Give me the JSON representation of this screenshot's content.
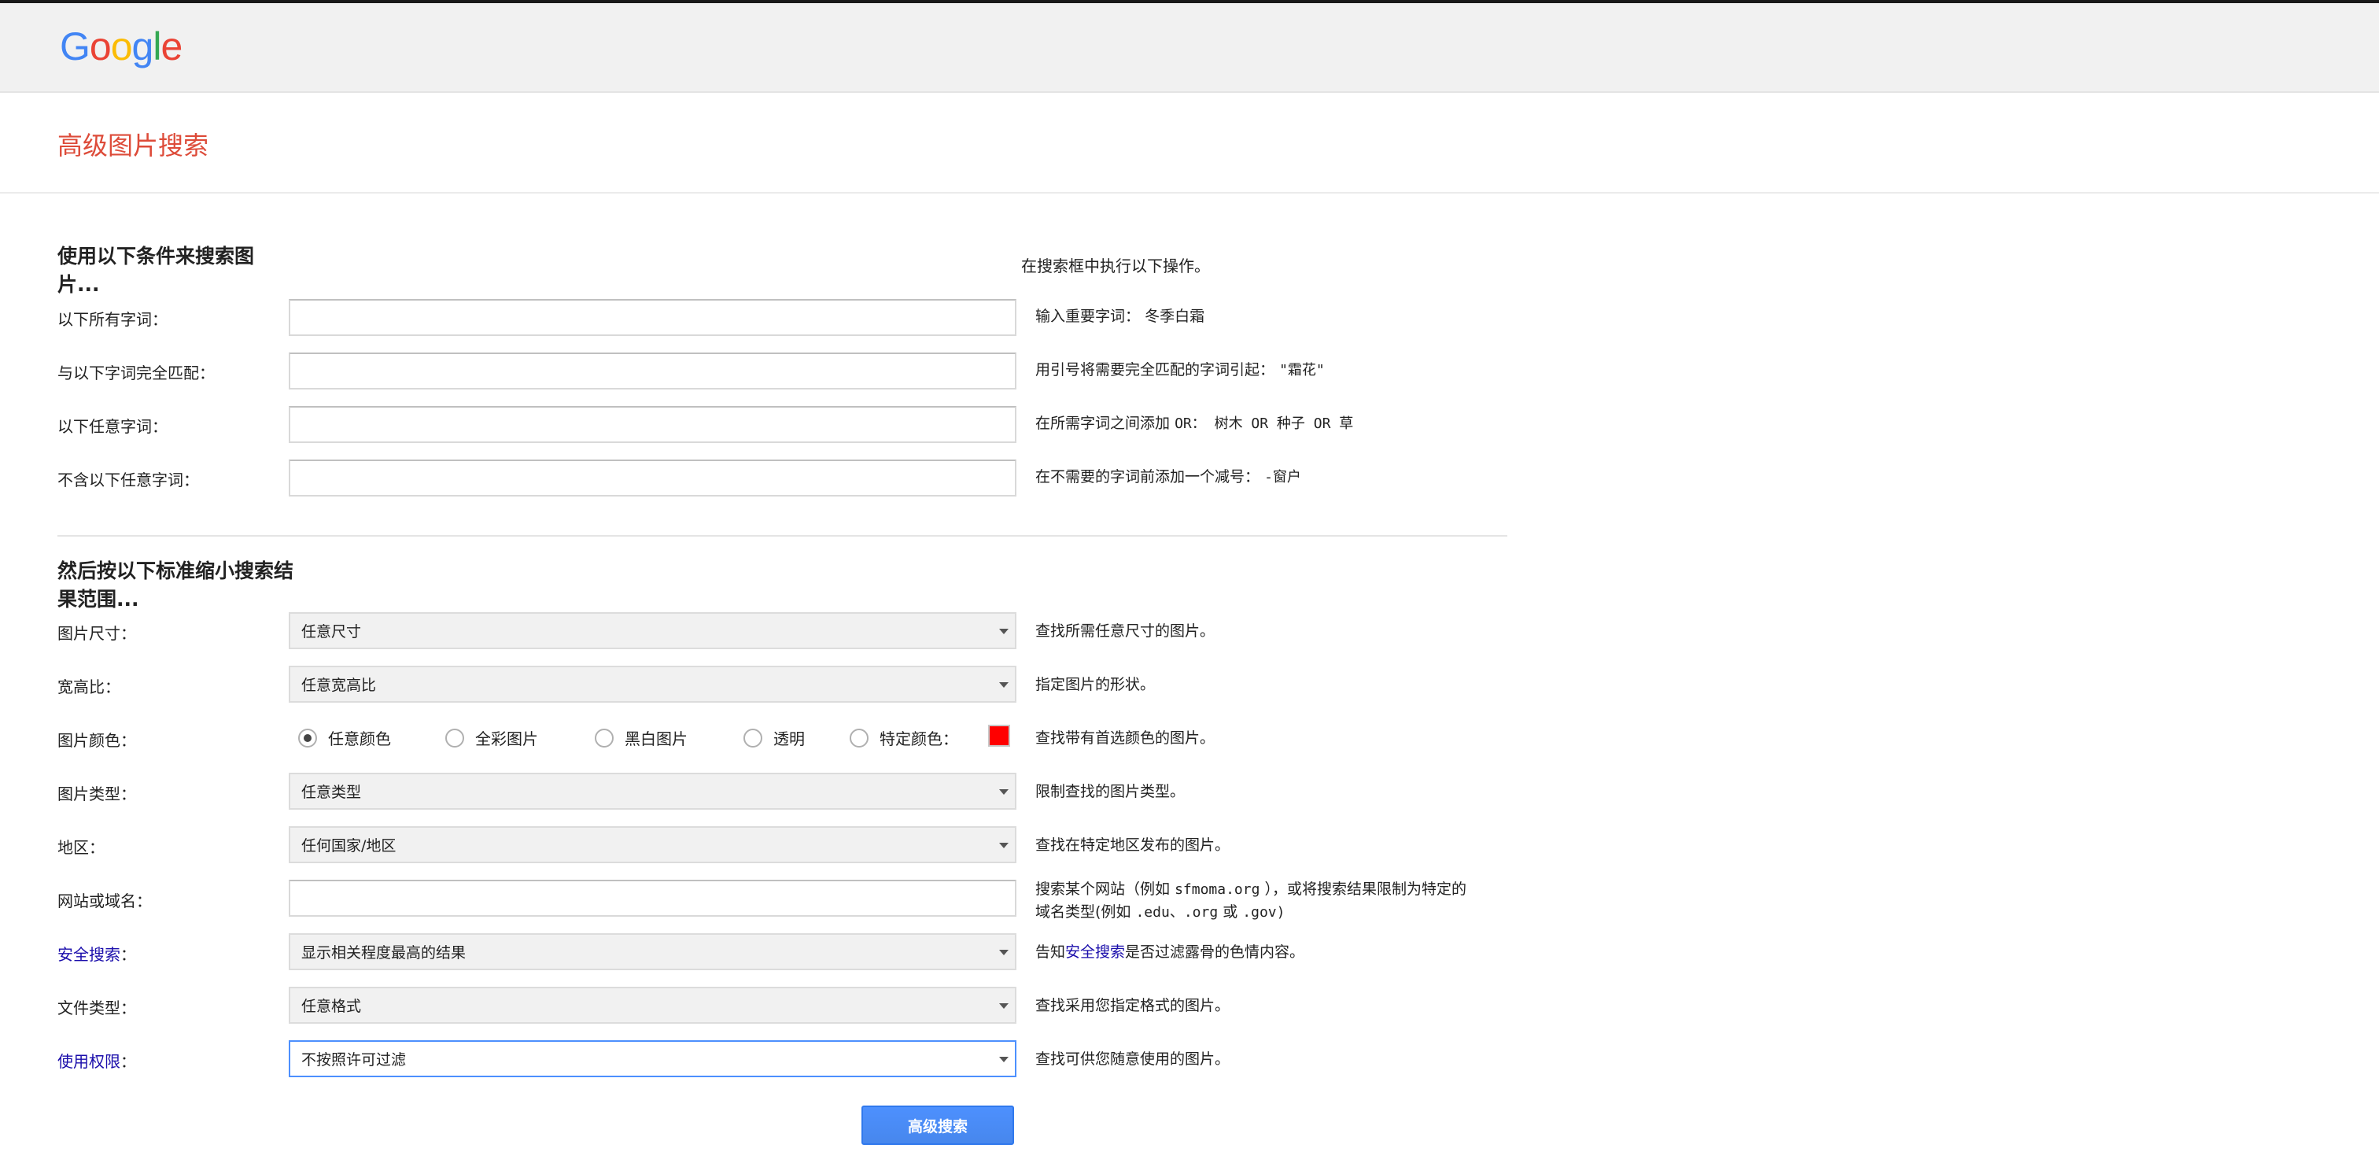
{
  "header": {
    "logo": [
      "G",
      "o",
      "o",
      "g",
      "l",
      "e"
    ],
    "logo_colors": [
      "#4285f4",
      "#ea4335",
      "#fbbc05",
      "#4285f4",
      "#34a853",
      "#ea4335"
    ]
  },
  "page_title": "高级图片搜索",
  "section1": {
    "title": "使用以下条件来搜索图片...",
    "hint_head": "在搜索框中执行以下操作。",
    "rows": [
      {
        "label": "以下所有字词：",
        "value": "",
        "hint_prefix": "输入重要字词：",
        "hint_example": "冬季白霜"
      },
      {
        "label": "与以下字词完全匹配：",
        "value": "",
        "hint_prefix": "用引号将需要完全匹配的字词引起：",
        "hint_example": "\"霜花\""
      },
      {
        "label": "以下任意字词：",
        "value": "",
        "hint_prefix": "在所需字词之间添加",
        "hint_example": "OR：  树木 OR 种子 OR 草"
      },
      {
        "label": "不含以下任意字词：",
        "value": "",
        "hint_prefix": "在不需要的字词前添加一个减号：",
        "hint_example": "-窗户"
      }
    ]
  },
  "section2": {
    "title": "然后按以下标准缩小搜索结果范围...",
    "image_size": {
      "label": "图片尺寸：",
      "value": "任意尺寸",
      "hint": "查找所需任意尺寸的图片。"
    },
    "aspect_ratio": {
      "label": "宽高比：",
      "value": "任意宽高比",
      "hint": "指定图片的形状。"
    },
    "color": {
      "label": "图片颜色：",
      "options": [
        "任意颜色",
        "全彩图片",
        "黑白图片",
        "透明",
        "特定颜色："
      ],
      "selected": "任意颜色",
      "swatch_color": "#ff0000",
      "hint": "查找带有首选颜色的图片。"
    },
    "image_type": {
      "label": "图片类型：",
      "value": "任意类型",
      "hint": "限制查找的图片类型。"
    },
    "region": {
      "label": "地区：",
      "value": "任何国家/地区",
      "hint": "查找在特定地区发布的图片。"
    },
    "site": {
      "label": "网站或域名：",
      "value": "",
      "hint_line1_a": "搜索某个网站（例如",
      "hint_line1_code": "sfmoma.org",
      "hint_line1_b": "），或将搜索结果限制为特定的",
      "hint_line2_a": "域名类型(例如",
      "hint_line2_code": ".edu、.org",
      "hint_line2_b": "或",
      "hint_line2_code2": ".gov)"
    },
    "safesearch": {
      "label_link": "安全搜索",
      "label_colon": "：",
      "value": "显示相关程度最高的结果",
      "hint_a": "告知",
      "hint_link": "安全搜索",
      "hint_b": "是否过滤露骨的色情内容。"
    },
    "file_type": {
      "label": "文件类型：",
      "value": "任意格式",
      "hint": "查找采用您指定格式的图片。"
    },
    "usage_rights": {
      "label_link": "使用权限",
      "label_colon": "：",
      "value": "不按照许可过滤",
      "hint": "查找可供您随意使用的图片。"
    }
  },
  "submit_label": "高级搜索"
}
